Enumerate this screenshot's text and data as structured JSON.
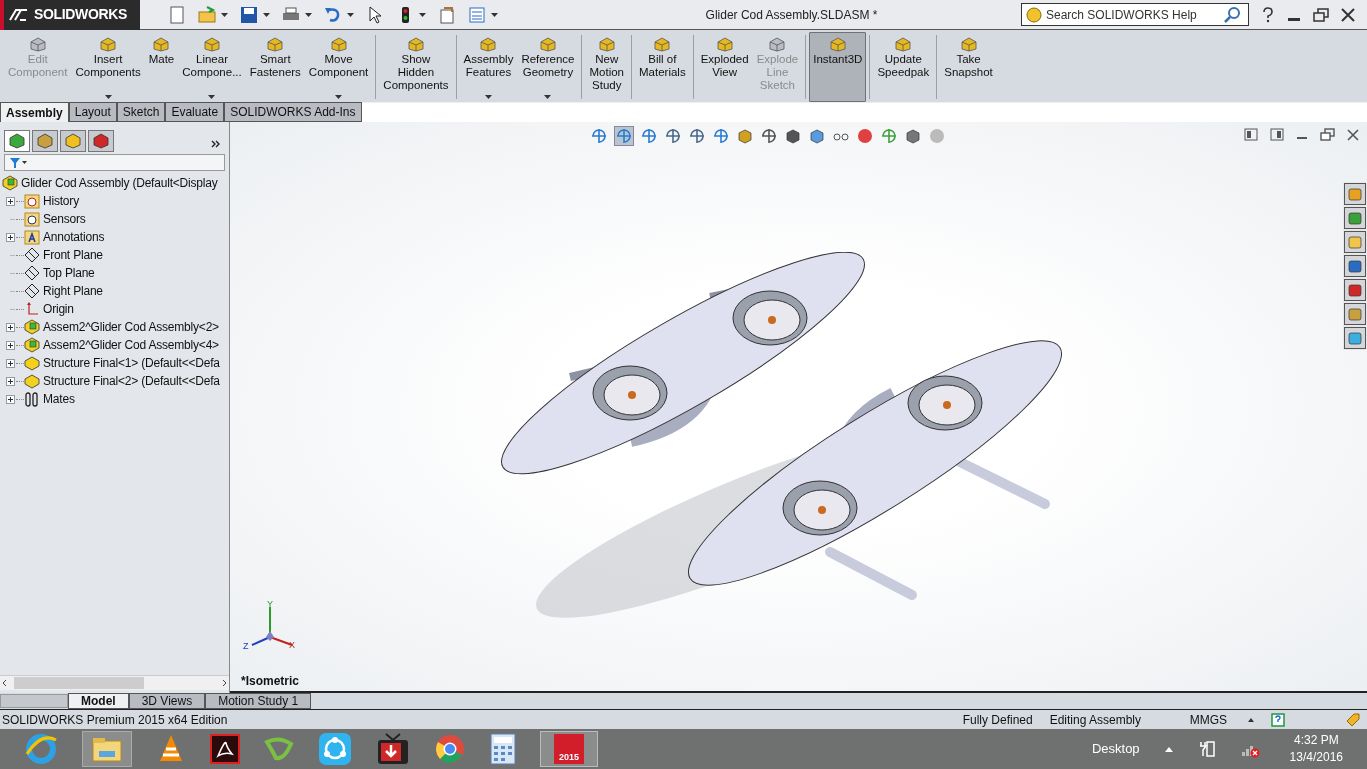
{
  "title_bar": {
    "logo": "SOLIDWORKS",
    "title": "Glider Cod Assembly.SLDASM *",
    "search": {
      "placeholder": "Search SOLIDWORKS Help"
    }
  },
  "ribbon": {
    "groups": [
      [
        {
          "label": "Edit\nComponent",
          "disabled": true,
          "dropdown": false,
          "selected": false
        },
        {
          "label": "Insert\nComponents",
          "disabled": false,
          "dropdown": true,
          "selected": false
        },
        {
          "label": "Mate",
          "disabled": false,
          "dropdown": false,
          "selected": false
        },
        {
          "label": "Linear\nCompone...",
          "disabled": false,
          "dropdown": true,
          "selected": false
        },
        {
          "label": "Smart\nFasteners",
          "disabled": false,
          "dropdown": false,
          "selected": false
        },
        {
          "label": "Move\nComponent",
          "disabled": false,
          "dropdown": true,
          "selected": false
        }
      ],
      [
        {
          "label": "Show\nHidden\nComponents",
          "disabled": false,
          "dropdown": false,
          "selected": false
        }
      ],
      [
        {
          "label": "Assembly\nFeatures",
          "disabled": false,
          "dropdown": true,
          "selected": false
        },
        {
          "label": "Reference\nGeometry",
          "disabled": false,
          "dropdown": true,
          "selected": false
        }
      ],
      [
        {
          "label": "New\nMotion\nStudy",
          "disabled": false,
          "dropdown": false,
          "selected": false
        }
      ],
      [
        {
          "label": "Bill of\nMaterials",
          "disabled": false,
          "dropdown": false,
          "selected": false
        }
      ],
      [
        {
          "label": "Exploded\nView",
          "disabled": false,
          "dropdown": false,
          "selected": false
        },
        {
          "label": "Explode\nLine\nSketch",
          "disabled": true,
          "dropdown": false,
          "selected": false
        }
      ],
      [
        {
          "label": "Instant3D",
          "disabled": false,
          "dropdown": false,
          "selected": true
        }
      ],
      [
        {
          "label": "Update\nSpeedpak",
          "disabled": false,
          "dropdown": false,
          "selected": false
        }
      ],
      [
        {
          "label": "Take\nSnapshot",
          "disabled": false,
          "dropdown": false,
          "selected": false
        }
      ]
    ]
  },
  "command_tabs": [
    {
      "label": "Assembly",
      "selected": true
    },
    {
      "label": "Layout",
      "selected": false
    },
    {
      "label": "Sketch",
      "selected": false
    },
    {
      "label": "Evaluate",
      "selected": false
    },
    {
      "label": "SOLIDWORKS Add-Ins",
      "selected": false
    }
  ],
  "feature_tree": {
    "root": {
      "label": "Glider Cod Assembly  (Default<Display",
      "kind": "assembly",
      "children": [
        {
          "label": "History",
          "kind": "history",
          "expandable": true
        },
        {
          "label": "Sensors",
          "kind": "sensors",
          "expandable": false
        },
        {
          "label": "Annotations",
          "kind": "annotations",
          "expandable": true
        },
        {
          "label": "Front Plane",
          "kind": "plane",
          "expandable": false
        },
        {
          "label": "Top Plane",
          "kind": "plane",
          "expandable": false
        },
        {
          "label": "Right Plane",
          "kind": "plane",
          "expandable": false
        },
        {
          "label": "Origin",
          "kind": "origin",
          "expandable": false
        },
        {
          "label": "Assem2^Glider Cod Assembly<2>",
          "kind": "assembly",
          "expandable": true
        },
        {
          "label": "Assem2^Glider Cod Assembly<4>",
          "kind": "assembly",
          "expandable": true
        },
        {
          "label": "Structure Final<1>  (Default<<Defa",
          "kind": "part",
          "expandable": true
        },
        {
          "label": "Structure Final<2>  (Default<<Defa",
          "kind": "part",
          "expandable": true
        },
        {
          "label": "Mates",
          "kind": "mates",
          "expandable": true
        }
      ]
    }
  },
  "viewport": {
    "view_label": "*Isometric",
    "triad": {
      "x": "X",
      "y": "Y",
      "z": "Z"
    }
  },
  "bottom_tabs": [
    {
      "label": "Model",
      "selected": true
    },
    {
      "label": "3D Views",
      "selected": false
    },
    {
      "label": "Motion Study 1",
      "selected": false
    }
  ],
  "status_bar": {
    "edition": "SOLIDWORKS Premium 2015 x64 Edition",
    "state": "Fully Defined",
    "mode": "Editing Assembly",
    "units": "MMGS"
  },
  "taskbar": {
    "sw_badge": "2015",
    "desktop": "Desktop",
    "time": "4:32 PM",
    "date": "13/4/2016"
  }
}
